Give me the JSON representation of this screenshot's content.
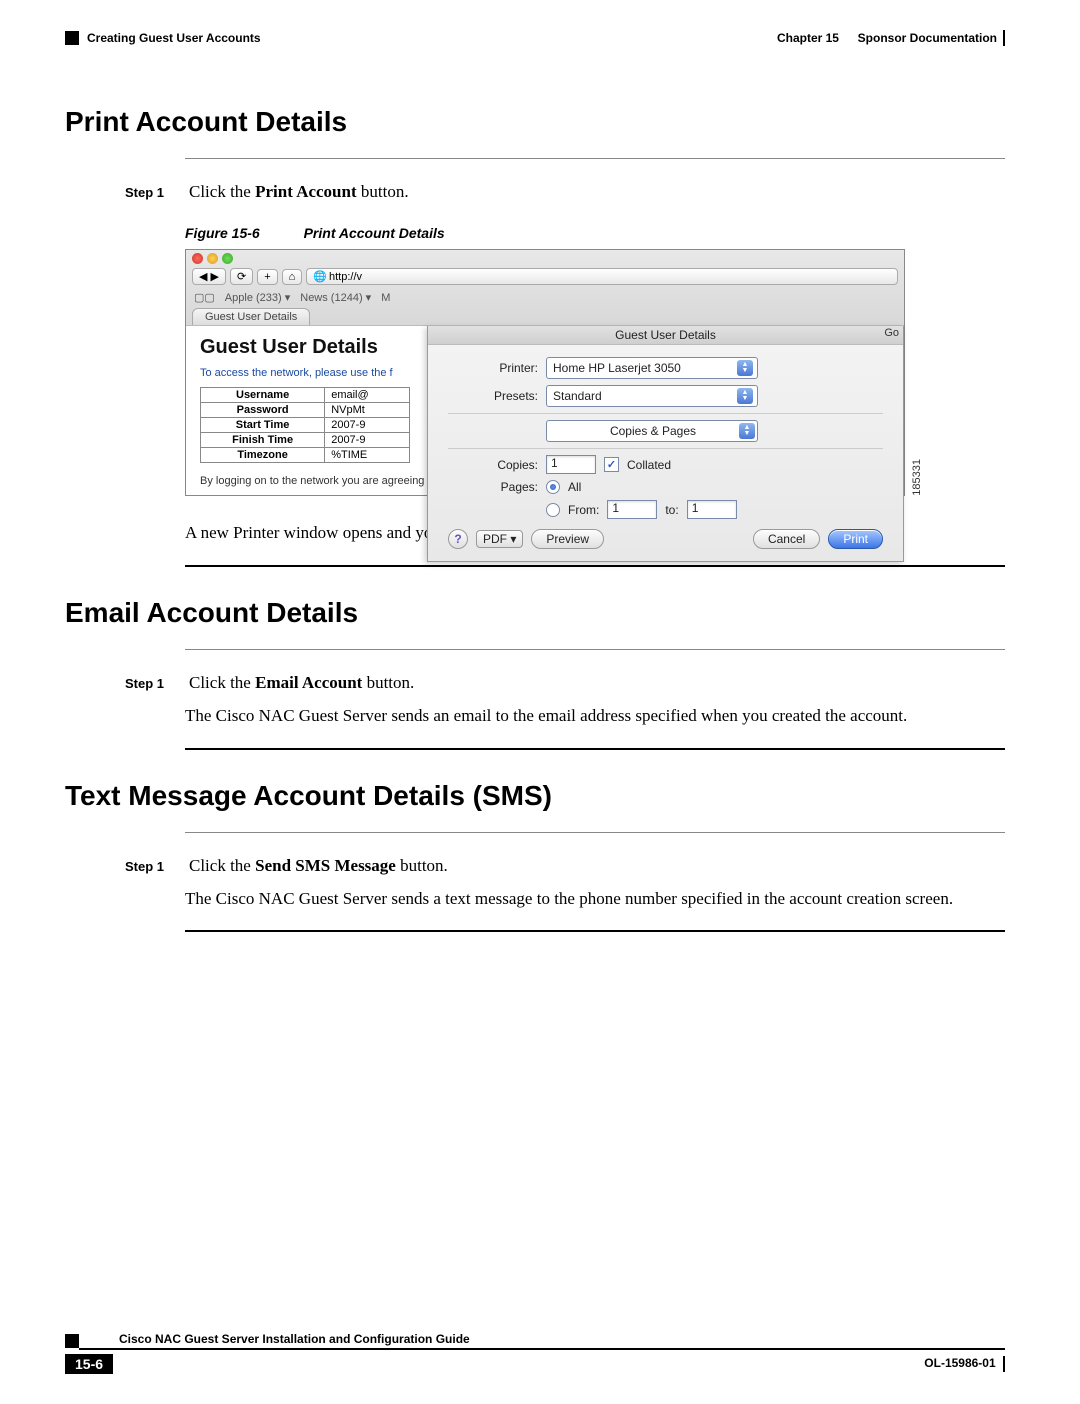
{
  "header": {
    "left": "Creating Guest User Accounts",
    "right_chapter": "Chapter 15",
    "right_title": "Sponsor Documentation"
  },
  "sections": {
    "print": {
      "heading": "Print Account Details",
      "step_label": "Step 1",
      "step_text_pre": "Click the ",
      "step_bold": "Print Account",
      "step_text_post": " button.",
      "figure_num": "Figure 15-6",
      "figure_title": "Print Account Details",
      "after_text": "A new Printer window opens and you can print out the guest user details."
    },
    "email": {
      "heading": "Email Account Details",
      "step_label": "Step 1",
      "step_text_pre": "Click the ",
      "step_bold": "Email Account",
      "step_text_post": " button.",
      "follow": "The Cisco NAC Guest Server sends an email to the email address specified when you created the account."
    },
    "sms": {
      "heading": "Text Message Account Details (SMS)",
      "step_label": "Step 1",
      "step_text_pre": "Click the ",
      "step_bold": "Send SMS Message",
      "step_text_post": " button.",
      "follow": "The Cisco NAC Guest Server sends a text message to the phone number specified in the account creation screen."
    }
  },
  "screenshot": {
    "id_number": "185331",
    "browser": {
      "url_prefix": "http://v",
      "bookmarks": {
        "apple": "Apple (233) ▾",
        "news": "News (1244) ▾",
        "more": "M"
      },
      "tab": "Guest User Details",
      "page_title": "Guest User Details",
      "subtitle": "To access the network, please use the f",
      "table": {
        "rows": [
          {
            "k": "Username",
            "v": "email@"
          },
          {
            "k": "Password",
            "v": "NVpMt"
          },
          {
            "k": "Start Time",
            "v": "2007-9"
          },
          {
            "k": "Finish Time",
            "v": "2007-9"
          },
          {
            "k": "Timezone",
            "v": "%TIME"
          }
        ]
      },
      "disclaimer": "By logging on to the network you are agreeing to the terms and conditions of the acceptable use policy below"
    },
    "print_dialog": {
      "title": "Guest User Details",
      "go": "Go",
      "printer_label": "Printer:",
      "printer_value": "Home HP Laserjet 3050",
      "presets_label": "Presets:",
      "presets_value": "Standard",
      "section_value": "Copies & Pages",
      "copies_label": "Copies:",
      "copies_value": "1",
      "collated_label": "Collated",
      "pages_label": "Pages:",
      "pages_all": "All",
      "pages_from": "From:",
      "from_value": "1",
      "to_label": "to:",
      "to_value": "1",
      "help": "?",
      "pdf": "PDF ▾",
      "preview": "Preview",
      "cancel": "Cancel",
      "print": "Print"
    }
  },
  "footer": {
    "guide": "Cisco NAC Guest Server Installation and Configuration Guide",
    "page": "15-6",
    "doc": "OL-15986-01"
  }
}
